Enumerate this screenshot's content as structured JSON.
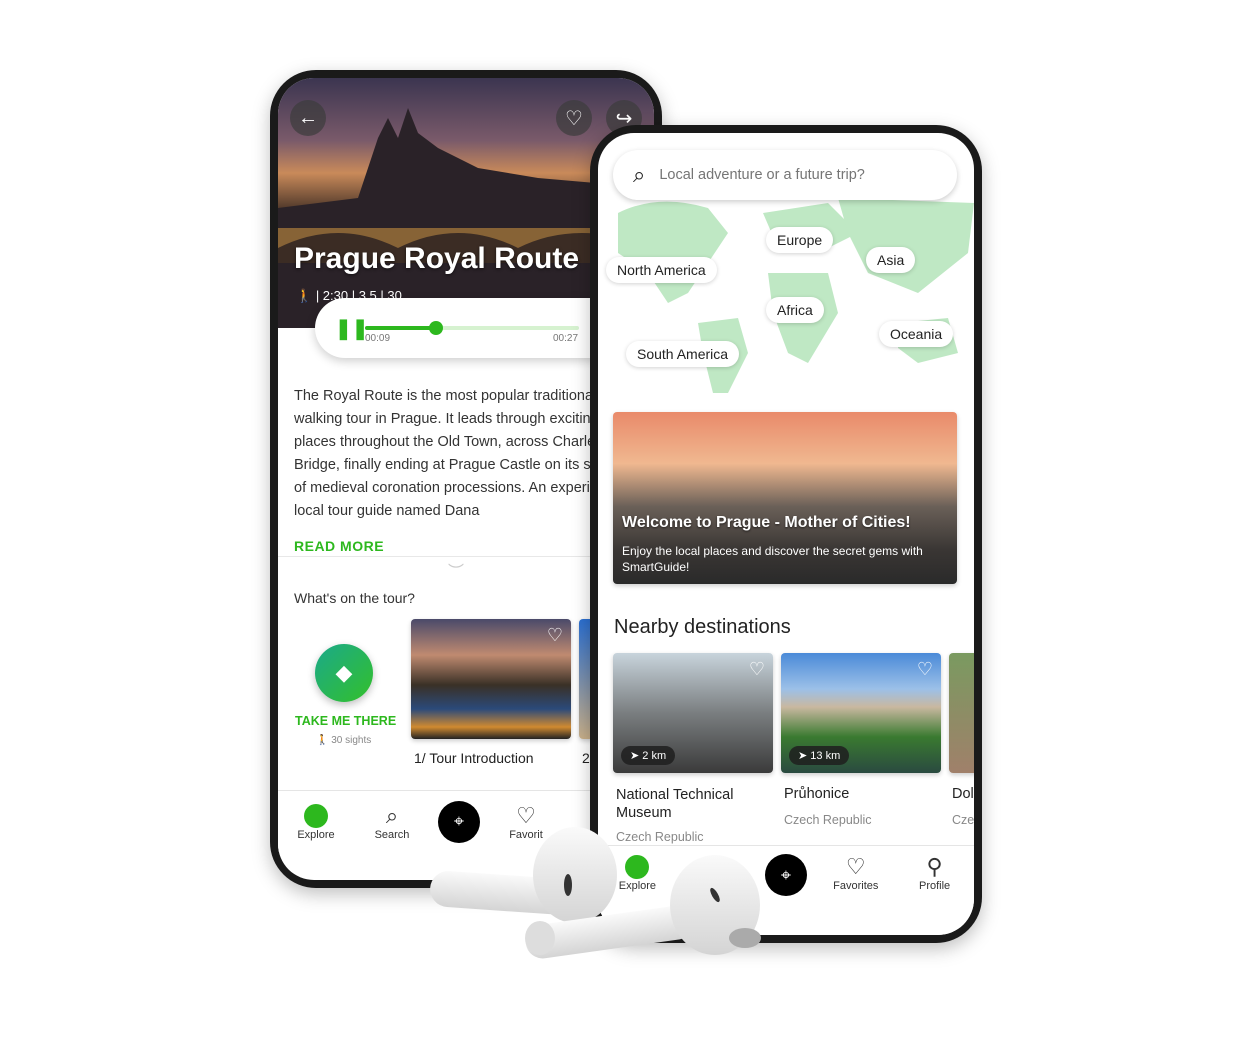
{
  "tour": {
    "title": "Prague Royal Route",
    "meta": "| 2:30 | 3.5 |   30",
    "player": {
      "elapsed": "00:09",
      "total": "00:27",
      "progress": 0.33
    },
    "description": "The Royal Route is the most popular traditional walking tour in Prague. It leads through exciting places throughout the Old Town, across Charles Bridge, finally ending at Prague Castle on its steps of medieval coronation processions. An experienced local tour guide named Dana",
    "read_more": "READ MORE",
    "section_title": "What's on the tour?",
    "take_me_there": "TAKE ME THERE",
    "sights": "30 sights",
    "stops": [
      {
        "label": "1/ Tour Introduction"
      },
      {
        "label": "2"
      }
    ],
    "nav": [
      "Explore",
      "Search",
      "",
      "Favorit"
    ]
  },
  "explore": {
    "search_placeholder": "Local adventure or a future trip?",
    "regions": [
      "North America",
      "Europe",
      "Asia",
      "Africa",
      "Oceania",
      "South America"
    ],
    "banner": {
      "title": "Welcome to Prague - Mother of Cities!",
      "subtitle": "Enjoy the local places and discover the secret gems with SmartGuide!"
    },
    "nearby_title": "Nearby destinations",
    "destinations": [
      {
        "name": "National Technical Museum",
        "country": "Czech Republic",
        "distance": "2 km"
      },
      {
        "name": "Průhonice",
        "country": "Czech Republic",
        "distance": "13 km"
      },
      {
        "name": "Dol",
        "country": "Cze",
        "distance": ""
      }
    ],
    "nav": [
      "Explore",
      "",
      "",
      "Favorites",
      "Profile"
    ]
  },
  "colors": {
    "accent": "#2db81e",
    "map_land": "#bfe8c4"
  }
}
